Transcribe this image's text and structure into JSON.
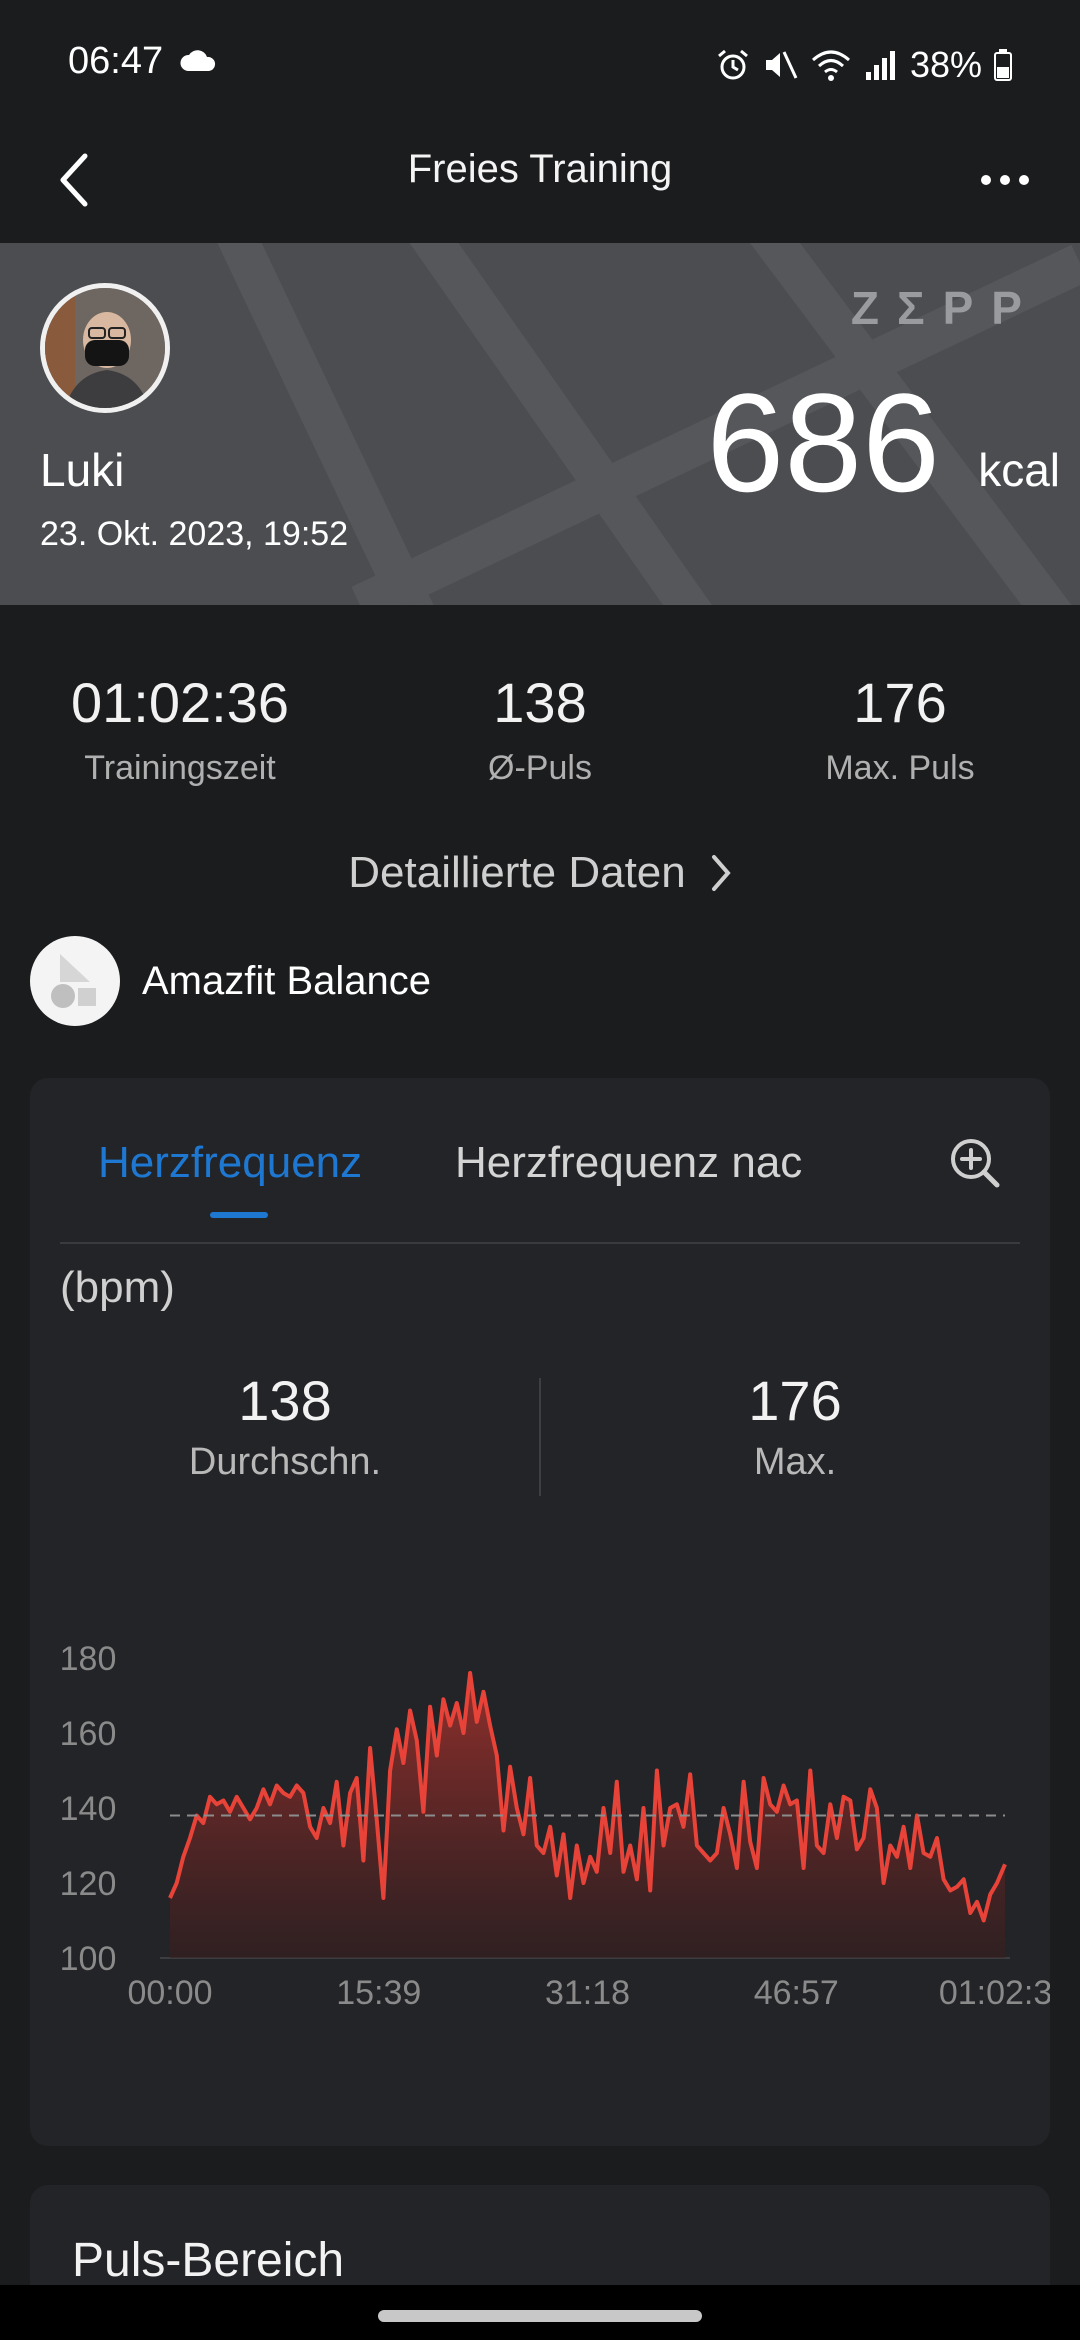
{
  "status": {
    "time": "06:47",
    "battery": "38%"
  },
  "header": {
    "title": "Freies Training"
  },
  "hero": {
    "brand": "ZΣPP",
    "name": "Luki",
    "date": "23. Okt. 2023, 19:52",
    "kcal": "686",
    "kcal_unit": "kcal"
  },
  "stats": [
    {
      "value": "01:02:36",
      "label": "Trainingszeit"
    },
    {
      "value": "138",
      "label": "Ø-Puls"
    },
    {
      "value": "176",
      "label": "Max. Puls"
    }
  ],
  "detail_link": "Detaillierte Daten",
  "device": {
    "name": "Amazfit Balance"
  },
  "hr_card": {
    "tabs": [
      {
        "label": "Herzfrequenz"
      },
      {
        "label": "Herzfrequenz nac"
      }
    ],
    "unit": "(bpm)",
    "avg": {
      "value": "138",
      "label": "Durchschn."
    },
    "max": {
      "value": "176",
      "label": "Max."
    }
  },
  "chart_data": {
    "type": "area",
    "y_ticks": [
      "180",
      "160",
      "140",
      "120",
      "100"
    ],
    "x_ticks": [
      "00:00",
      "15:39",
      "31:18",
      "46:57",
      "01:02:36"
    ],
    "ylim": [
      100,
      180
    ],
    "xlim": [
      0,
      62.6
    ],
    "x_unit": "minutes",
    "average_line": 138,
    "line_color": "#e84339",
    "x": [
      0,
      0.5,
      1,
      1.5,
      2,
      2.5,
      3,
      3.5,
      4,
      4.5,
      5,
      5.5,
      6,
      6.5,
      7,
      7.5,
      8,
      8.5,
      9,
      9.5,
      10,
      10.5,
      11,
      11.5,
      12,
      12.5,
      13,
      13.5,
      14,
      14.5,
      15,
      15.5,
      16,
      16.5,
      17,
      17.5,
      18,
      18.5,
      19,
      19.5,
      20,
      20.5,
      21,
      21.5,
      22,
      22.5,
      23,
      23.5,
      24,
      24.5,
      25,
      25.5,
      26,
      26.5,
      27,
      27.5,
      28,
      28.5,
      29,
      29.5,
      30,
      30.5,
      31,
      31.5,
      32,
      32.5,
      33,
      33.5,
      34,
      34.5,
      35,
      35.5,
      36,
      36.5,
      37,
      37.5,
      38,
      38.5,
      39,
      39.5,
      40,
      40.5,
      41,
      41.5,
      42,
      42.5,
      43,
      43.5,
      44,
      44.5,
      45,
      45.5,
      46,
      46.5,
      47,
      47.5,
      48,
      48.5,
      49,
      49.5,
      50,
      50.5,
      51,
      51.5,
      52,
      52.5,
      53,
      53.5,
      54,
      54.5,
      55,
      55.5,
      56,
      56.5,
      57,
      57.5,
      58,
      58.5,
      59,
      59.5,
      60,
      60.5,
      61,
      61.5,
      62,
      62.6
    ],
    "values": [
      116,
      120,
      127,
      132,
      138,
      136,
      143,
      141,
      142,
      139,
      143,
      140,
      137,
      140,
      145,
      141,
      146,
      144,
      143,
      146,
      144,
      135,
      132,
      140,
      136,
      147,
      130,
      144,
      148,
      126,
      156,
      137,
      116,
      150,
      161,
      152,
      166,
      158,
      139,
      167,
      154,
      169,
      162,
      168,
      160,
      176,
      163,
      171,
      162,
      154,
      134,
      151,
      140,
      133,
      148,
      130,
      128,
      135,
      122,
      133,
      116,
      130,
      120,
      127,
      123,
      140,
      128,
      147,
      123,
      130,
      121,
      140,
      118,
      150,
      130,
      140,
      141,
      135,
      149,
      130,
      128,
      126,
      128,
      140,
      133,
      124,
      147,
      131,
      124,
      148,
      141,
      139,
      146,
      141,
      142,
      124,
      150,
      130,
      128,
      141,
      132,
      143,
      142,
      129,
      132,
      145,
      140,
      120,
      130,
      127,
      135,
      124,
      138,
      128,
      127,
      132,
      121,
      118,
      119,
      121,
      112,
      115,
      110,
      117,
      120,
      125
    ]
  },
  "pulse_card": {
    "title": "Puls-Bereich"
  }
}
